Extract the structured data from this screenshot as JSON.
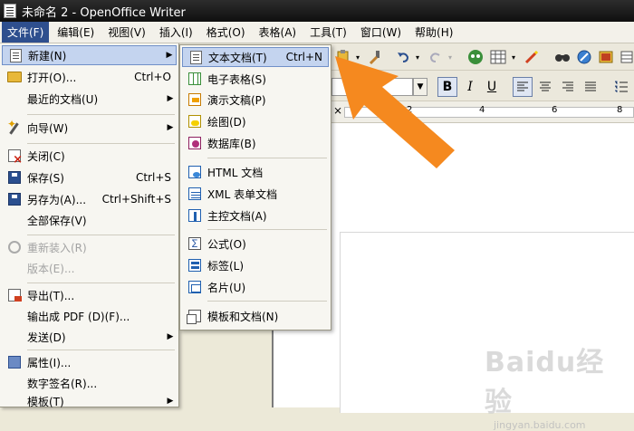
{
  "window": {
    "title": "未命名 2 - OpenOffice Writer"
  },
  "menubar": {
    "items": [
      {
        "label": "文件(F)"
      },
      {
        "label": "编辑(E)"
      },
      {
        "label": "视图(V)"
      },
      {
        "label": "插入(I)"
      },
      {
        "label": "格式(O)"
      },
      {
        "label": "表格(A)"
      },
      {
        "label": "工具(T)"
      },
      {
        "label": "窗口(W)"
      },
      {
        "label": "帮助(H)"
      }
    ]
  },
  "file_menu": {
    "items": [
      {
        "label": "新建(N)",
        "shortcut": "",
        "has_submenu": true,
        "icon": "new-document-icon"
      },
      {
        "label": "打开(O)...",
        "shortcut": "Ctrl+O",
        "has_submenu": false,
        "icon": "open-folder-icon"
      },
      {
        "label": "最近的文档(U)",
        "shortcut": "",
        "has_submenu": true,
        "icon": ""
      },
      {
        "label": "向导(W)",
        "shortcut": "",
        "has_submenu": true,
        "icon": "wizard-wand-icon"
      },
      {
        "label": "关闭(C)",
        "shortcut": "",
        "has_submenu": false,
        "icon": "close-document-icon"
      },
      {
        "label": "保存(S)",
        "shortcut": "Ctrl+S",
        "has_submenu": false,
        "icon": "save-icon"
      },
      {
        "label": "另存为(A)...",
        "shortcut": "Ctrl+Shift+S",
        "has_submenu": false,
        "icon": "save-as-icon"
      },
      {
        "label": "全部保存(V)",
        "shortcut": "",
        "has_submenu": false,
        "icon": ""
      },
      {
        "label": "重新装入(R)",
        "shortcut": "",
        "has_submenu": false,
        "icon": "reload-icon",
        "disabled": true
      },
      {
        "label": "版本(E)...",
        "shortcut": "",
        "has_submenu": false,
        "icon": "",
        "disabled": true
      },
      {
        "label": "导出(T)...",
        "shortcut": "",
        "has_submenu": false,
        "icon": "export-icon"
      },
      {
        "label": "输出成 PDF (D)(F)...",
        "shortcut": "",
        "has_submenu": false,
        "icon": ""
      },
      {
        "label": "发送(D)",
        "shortcut": "",
        "has_submenu": true,
        "icon": ""
      },
      {
        "label": "属性(I)...",
        "shortcut": "",
        "has_submenu": false,
        "icon": "properties-icon"
      },
      {
        "label": "数字签名(R)...",
        "shortcut": "",
        "has_submenu": false,
        "icon": ""
      },
      {
        "label": "模板(T)",
        "shortcut": "",
        "has_submenu": true,
        "icon": ""
      }
    ]
  },
  "new_menu": {
    "items": [
      {
        "label": "文本文档(T)",
        "shortcut": "Ctrl+N",
        "icon": "text-document-icon"
      },
      {
        "label": "电子表格(S)",
        "shortcut": "",
        "icon": "spreadsheet-icon"
      },
      {
        "label": "演示文稿(P)",
        "shortcut": "",
        "icon": "presentation-icon"
      },
      {
        "label": "绘图(D)",
        "shortcut": "",
        "icon": "drawing-icon"
      },
      {
        "label": "数据库(B)",
        "shortcut": "",
        "icon": "database-icon"
      },
      {
        "label": "HTML 文档",
        "shortcut": "",
        "icon": "html-document-icon"
      },
      {
        "label": "XML 表单文档",
        "shortcut": "",
        "icon": "xml-form-icon"
      },
      {
        "label": "主控文档(A)",
        "shortcut": "",
        "icon": "master-document-icon"
      },
      {
        "label": "公式(O)",
        "shortcut": "",
        "icon": "formula-icon"
      },
      {
        "label": "标签(L)",
        "shortcut": "",
        "icon": "labels-icon"
      },
      {
        "label": "名片(U)",
        "shortcut": "",
        "icon": "business-card-icon"
      },
      {
        "label": "模板和文档(N)",
        "shortcut": "",
        "icon": "templates-icon"
      }
    ]
  },
  "ruler": {
    "ticks": [
      "2",
      "4",
      "6",
      "8"
    ]
  },
  "watermark": {
    "brand": "Baidu经验",
    "url": "jingyan.baidu.com"
  },
  "colors": {
    "highlight": "#c4d4ef",
    "menu_active": "#2e4f8e",
    "arrow": "#f5891f"
  }
}
